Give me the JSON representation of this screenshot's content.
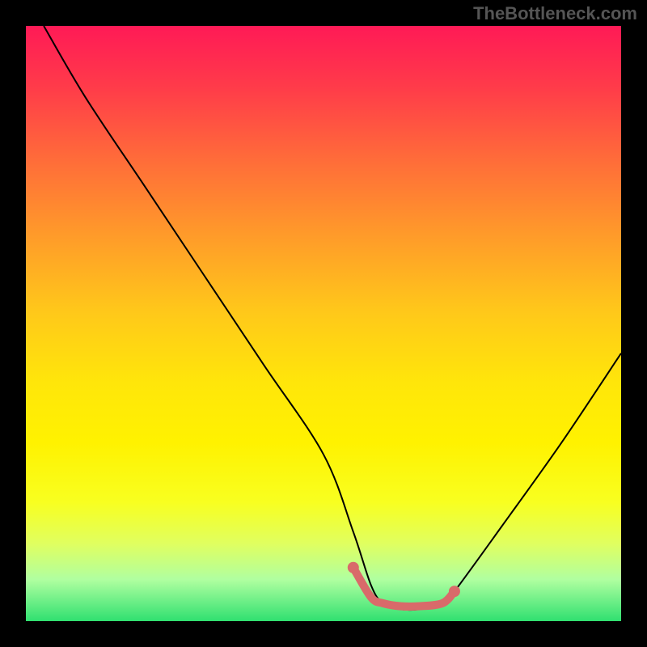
{
  "watermark": "TheBottleneck.com",
  "chart_data": {
    "type": "line",
    "title": "",
    "xlabel": "",
    "ylabel": "",
    "xlim": [
      0,
      100
    ],
    "ylim": [
      0,
      100
    ],
    "series": [
      {
        "name": "bottleneck-curve",
        "x": [
          3,
          10,
          20,
          30,
          40,
          50,
          55,
          58,
          60,
          63,
          66,
          70,
          72,
          80,
          90,
          100
        ],
        "y": [
          100,
          88,
          73,
          58,
          43,
          28,
          15,
          6,
          3,
          2,
          2,
          3,
          5,
          16,
          30,
          45
        ]
      }
    ],
    "highlight": {
      "name": "optimal-zone",
      "color": "#d96a6a",
      "x": [
        55,
        58,
        60,
        63,
        66,
        70,
        72
      ],
      "y": [
        9,
        4,
        3,
        2.5,
        2.5,
        3,
        5
      ]
    },
    "gradient_stops": [
      {
        "pos": 0.0,
        "color": "#ff1a56"
      },
      {
        "pos": 0.5,
        "color": "#ffe60a"
      },
      {
        "pos": 1.0,
        "color": "#30e070"
      }
    ]
  }
}
